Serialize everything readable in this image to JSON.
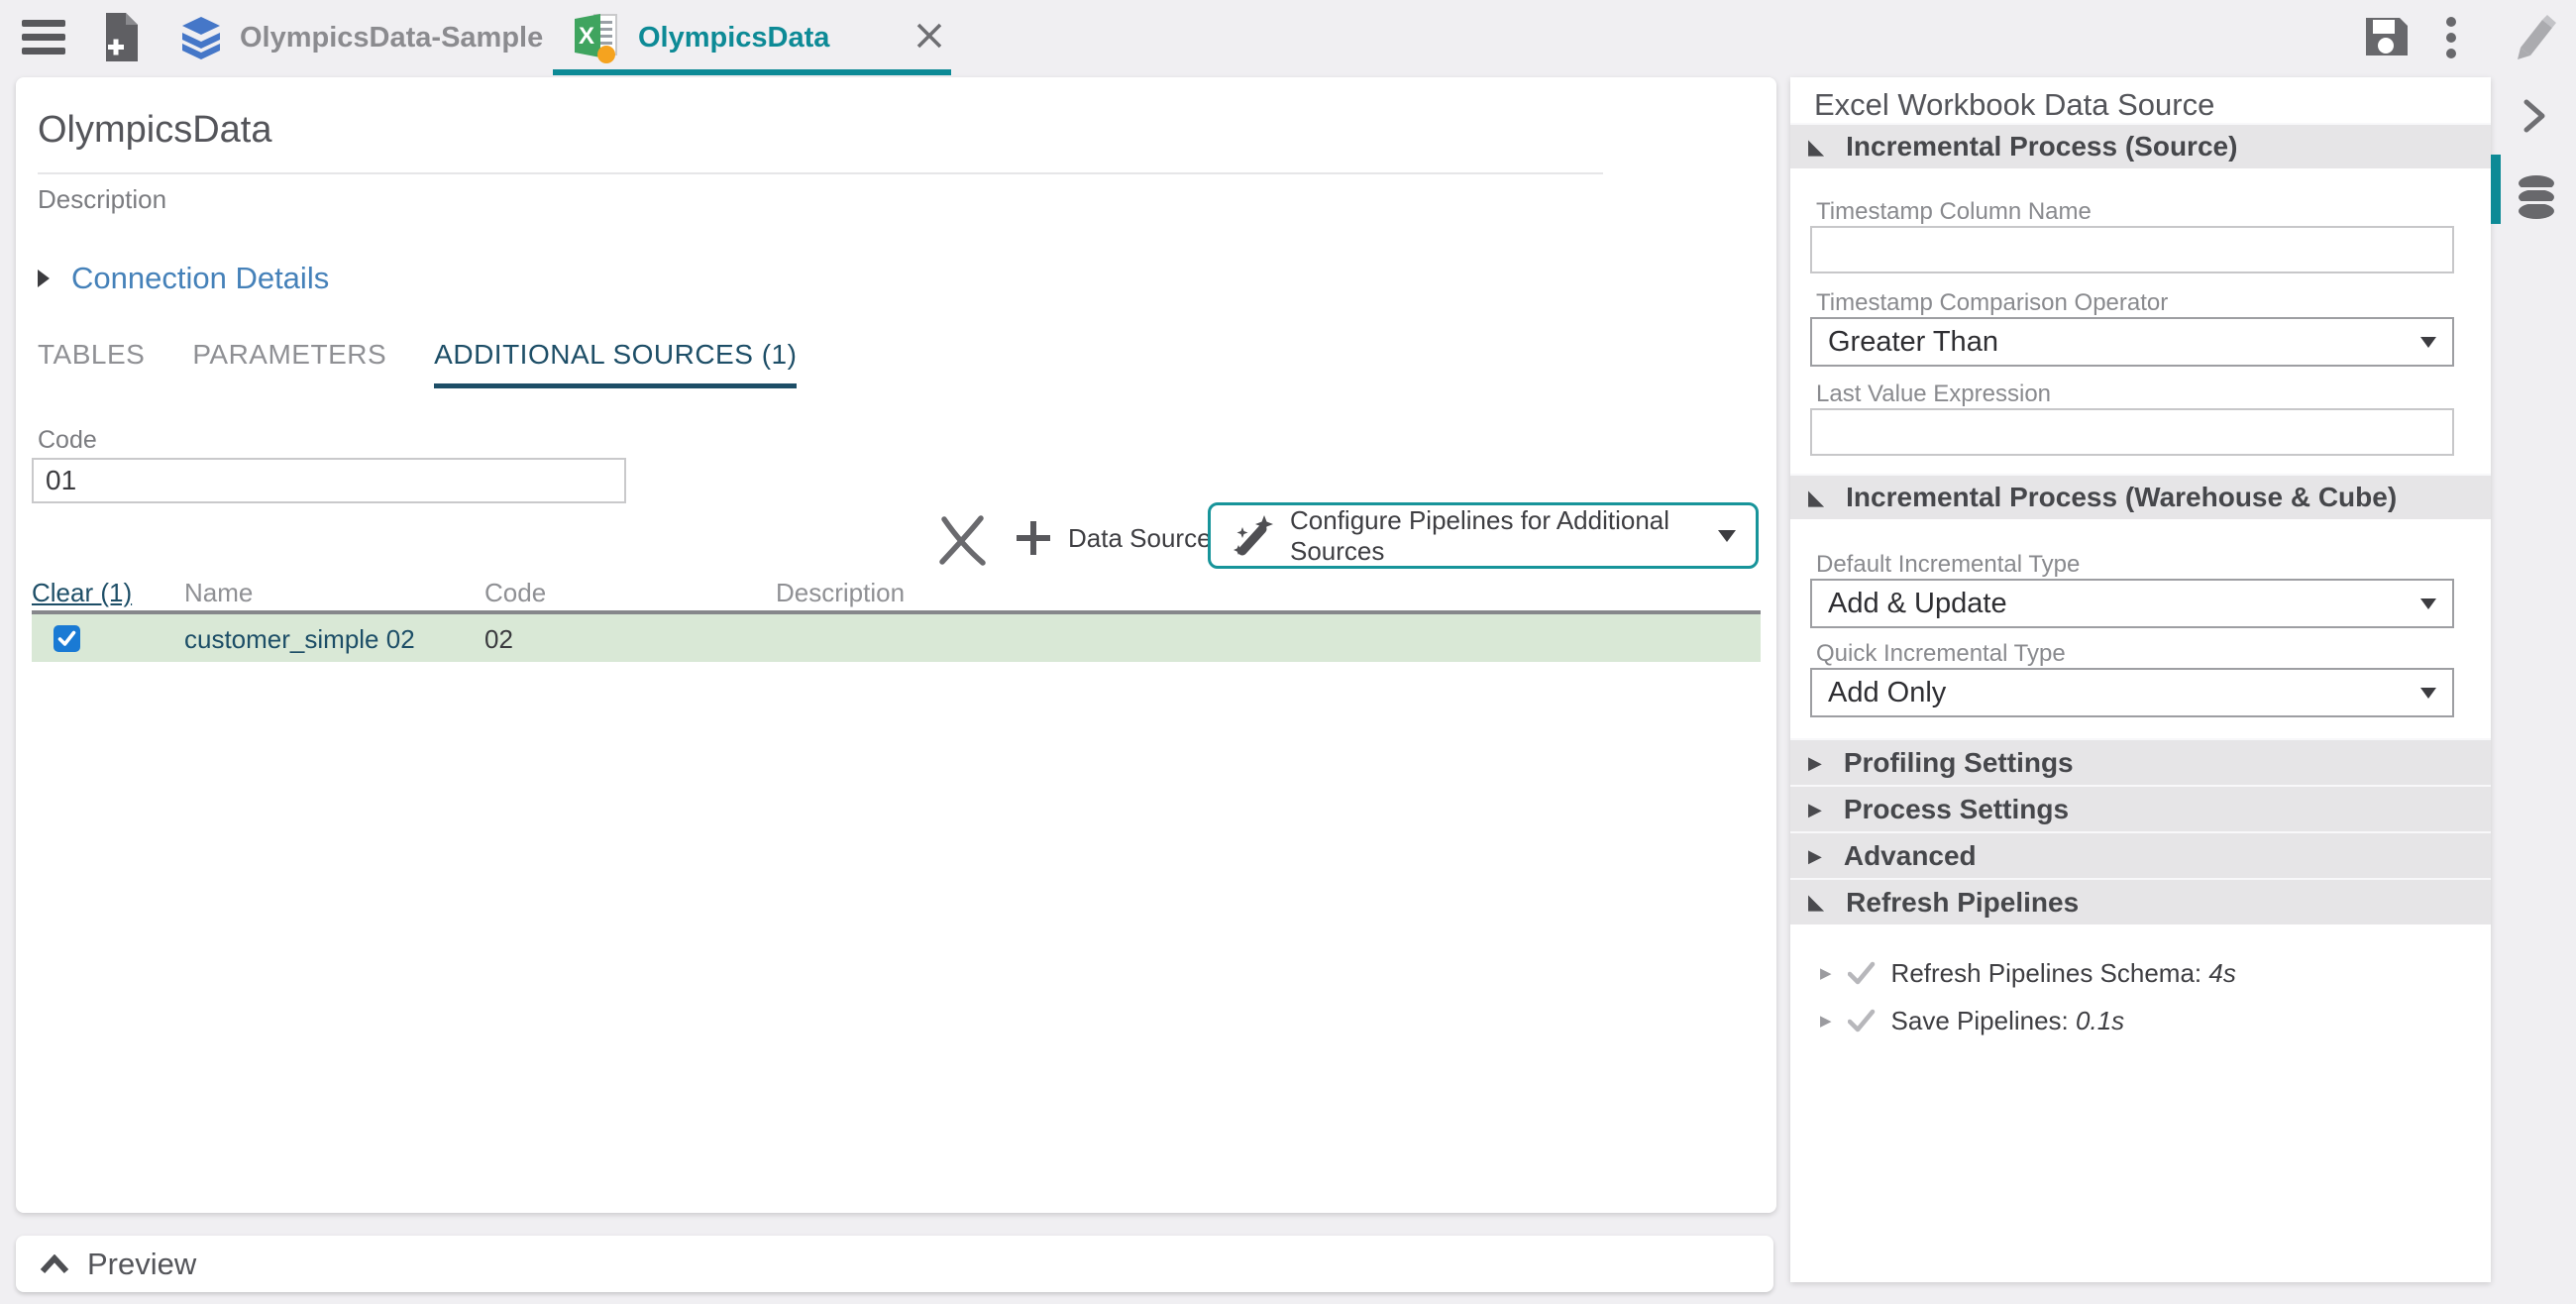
{
  "colors": {
    "teal_accent": "#0d8a96",
    "navy_active": "#1d4e67",
    "link_blue": "#4581b9",
    "row_highlight_green": "#d9e8d6",
    "checkbox_blue": "#1a7ad4"
  },
  "topbar": {
    "tabs": [
      {
        "label": "OlympicsData-Sample",
        "icon": "layers-icon",
        "active": false
      },
      {
        "label": "OlympicsData",
        "icon": "excel-icon",
        "active": true
      }
    ]
  },
  "main": {
    "title": "OlympicsData",
    "description_placeholder": "Description",
    "connection_details_label": "Connection Details",
    "tabs": [
      {
        "label": "TABLES"
      },
      {
        "label": "PARAMETERS"
      },
      {
        "label": "ADDITIONAL SOURCES (1)"
      }
    ],
    "code_field": {
      "label": "Code",
      "value": "01"
    },
    "actions": {
      "data_source_label": "Data Source",
      "configure_label": "Configure Pipelines for Additional Sources"
    },
    "table": {
      "clear_label": "Clear (1)",
      "columns": [
        "Name",
        "Code",
        "Description"
      ],
      "rows": [
        {
          "checked": true,
          "name": "customer_simple 02",
          "code": "02",
          "description": ""
        }
      ]
    },
    "preview_label": "Preview"
  },
  "panel": {
    "title": "Excel Workbook Data Source",
    "sections": [
      {
        "label": "Incremental Process (Source)",
        "expanded": true
      },
      {
        "label": "Incremental Process (Warehouse & Cube)",
        "expanded": true
      },
      {
        "label": "Profiling Settings",
        "expanded": false
      },
      {
        "label": "Process Settings",
        "expanded": false
      },
      {
        "label": "Advanced",
        "expanded": false
      },
      {
        "label": "Refresh Pipelines",
        "expanded": true
      }
    ],
    "fields": {
      "timestamp_column": {
        "label": "Timestamp Column Name",
        "value": ""
      },
      "timestamp_operator": {
        "label": "Timestamp Comparison Operator",
        "value": "Greater Than"
      },
      "last_value": {
        "label": "Last Value Expression",
        "value": ""
      },
      "default_incremental": {
        "label": "Default Incremental Type",
        "value": "Add & Update"
      },
      "quick_incremental": {
        "label": "Quick Incremental Type",
        "value": "Add Only"
      }
    },
    "pipelines": [
      {
        "label": "Refresh Pipelines Schema:",
        "time": "4s"
      },
      {
        "label": "Save Pipelines:",
        "time": "0.1s"
      }
    ]
  }
}
